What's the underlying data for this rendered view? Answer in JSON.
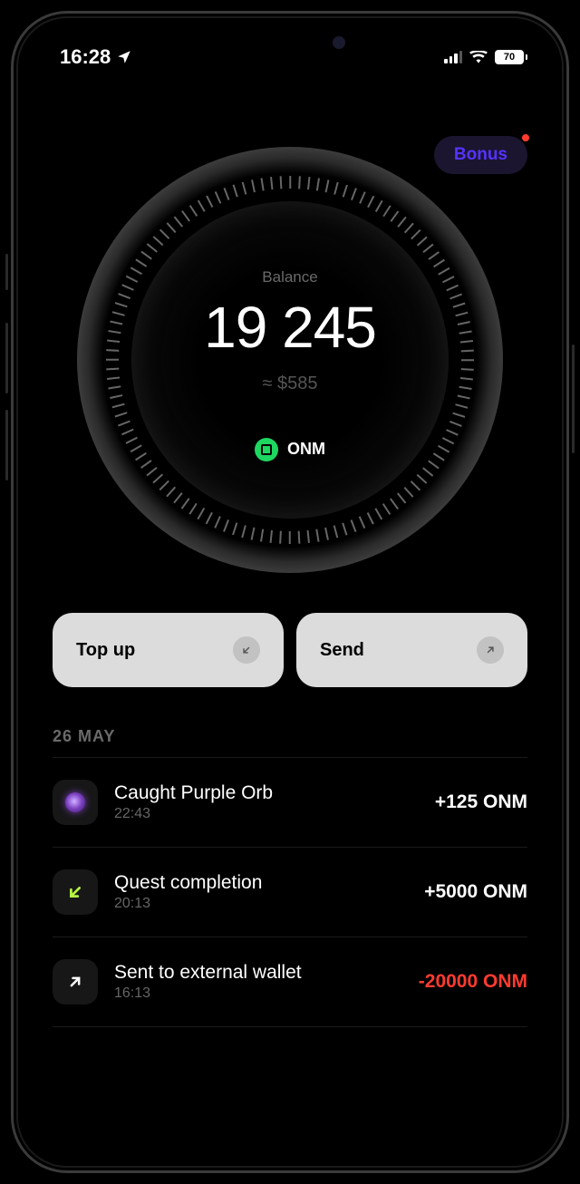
{
  "status": {
    "time": "16:28",
    "battery": "70"
  },
  "bonus": {
    "label": "Bonus"
  },
  "balance": {
    "label": "Balance",
    "amount": "19 245",
    "usd": "≈ $585",
    "token": "ONM"
  },
  "actions": {
    "topup": "Top up",
    "send": "Send"
  },
  "transactions": {
    "date": "26 MAY",
    "items": [
      {
        "title": "Caught Purple Orb",
        "time": "22:43",
        "amount": "+125 ONM",
        "color": "#ffffff"
      },
      {
        "title": "Quest completion",
        "time": "20:13",
        "amount": "+5000 ONM",
        "color": "#ffffff"
      },
      {
        "title": "Sent to external wallet",
        "time": "16:13",
        "amount": "-20000 ONM",
        "color": "#ff3b30"
      }
    ]
  }
}
